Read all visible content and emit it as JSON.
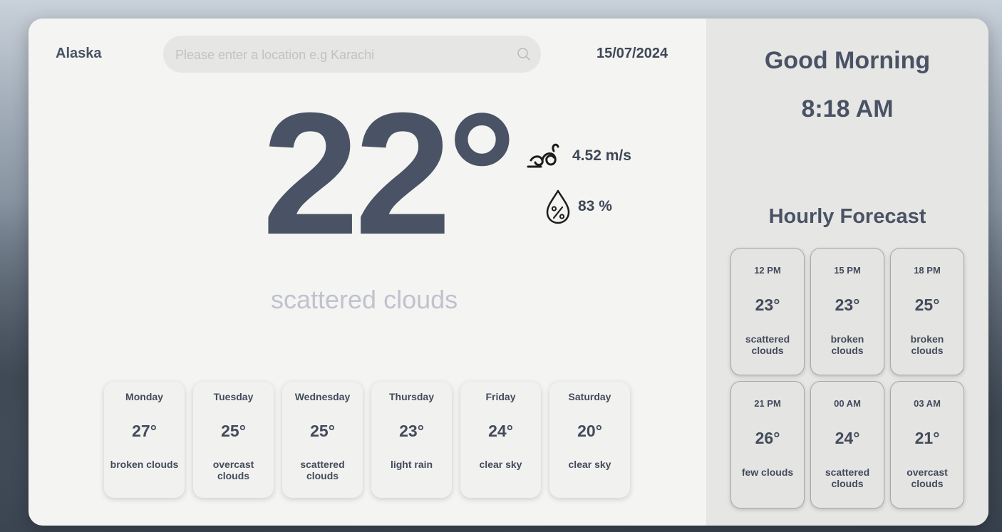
{
  "location": "Alaska",
  "search": {
    "placeholder": "Please enter a location e.g Karachi",
    "value": ""
  },
  "date": "15/07/2024",
  "current": {
    "temperature": "22°",
    "wind": "4.52 m/s",
    "humidity": "83 %",
    "description": "scattered clouds"
  },
  "daily": [
    {
      "day": "Monday",
      "temp": "27°",
      "desc": "broken clouds"
    },
    {
      "day": "Tuesday",
      "temp": "25°",
      "desc": "overcast clouds"
    },
    {
      "day": "Wednesday",
      "temp": "25°",
      "desc": "scattered clouds"
    },
    {
      "day": "Thursday",
      "temp": "23°",
      "desc": "light rain"
    },
    {
      "day": "Friday",
      "temp": "24°",
      "desc": "clear sky"
    },
    {
      "day": "Saturday",
      "temp": "20°",
      "desc": "clear sky"
    }
  ],
  "greeting": "Good Morning",
  "time": "8:18 AM",
  "hourly_title": "Hourly Forecast",
  "hourly": [
    {
      "time": "12 PM",
      "temp": "23°",
      "desc": "scattered clouds"
    },
    {
      "time": "15 PM",
      "temp": "23°",
      "desc": "broken clouds"
    },
    {
      "time": "18 PM",
      "temp": "25°",
      "desc": "broken clouds"
    },
    {
      "time": "21 PM",
      "temp": "26°",
      "desc": "few clouds"
    },
    {
      "time": "00 AM",
      "temp": "24°",
      "desc": "scattered clouds"
    },
    {
      "time": "03 AM",
      "temp": "21°",
      "desc": "overcast clouds"
    }
  ],
  "icons": {
    "search": "search-icon",
    "wind": "wind-icon",
    "humidity": "humidity-drop-icon"
  },
  "colors": {
    "primary_text": "#4a5365",
    "description_text": "#c0c2ce",
    "card_bg": "#f4f4f2",
    "panel_bg": "#e6e6e4"
  }
}
